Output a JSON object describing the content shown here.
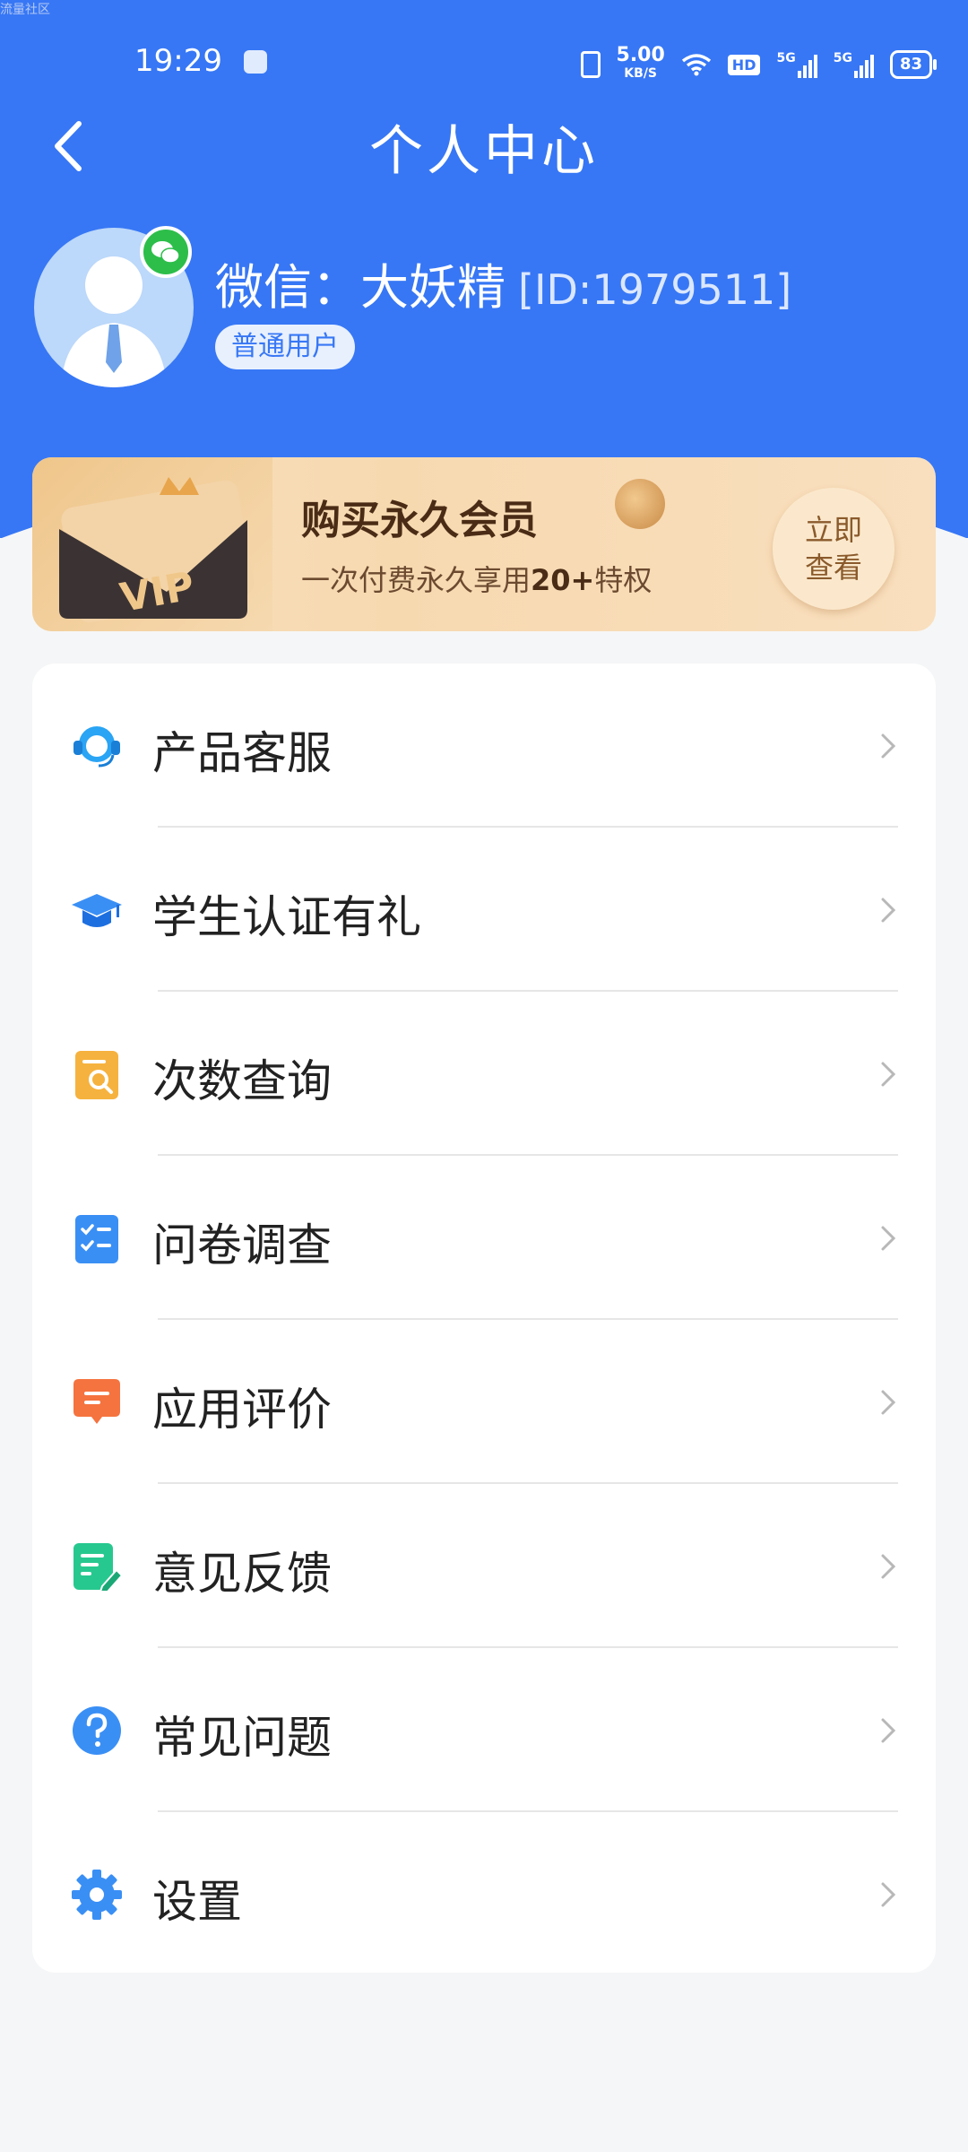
{
  "status_bar": {
    "time": "19:29",
    "net_speed_value": "5.00",
    "net_speed_unit": "KB/S",
    "hd_label": "HD",
    "signal1_label": "5G",
    "signal2_label": "5G",
    "battery": "83"
  },
  "watermark": "流量社区",
  "header": {
    "title": "个人中心",
    "back_icon": "chevron-left-icon"
  },
  "profile": {
    "name": "微信：大妖精",
    "id_text": "[ID:1979511]",
    "tag": "普通用户",
    "badge_icon": "wechat-icon"
  },
  "vip_banner": {
    "title": "购买永久会员",
    "subtitle_prefix": "一次付费永久享用",
    "subtitle_bold": "20+",
    "subtitle_suffix": "特权",
    "button_line1": "立即",
    "button_line2": "查看",
    "card_text": "VIP"
  },
  "menu": [
    {
      "label": "产品客服",
      "icon": "headset-icon",
      "color": "#2aa4f4"
    },
    {
      "label": "学生认证有礼",
      "icon": "graduation-cap-icon",
      "color": "#3a8ff5"
    },
    {
      "label": "次数查询",
      "icon": "search-document-icon",
      "color": "#f6b23e"
    },
    {
      "label": "问卷调查",
      "icon": "checklist-icon",
      "color": "#3a8ff5"
    },
    {
      "label": "应用评价",
      "icon": "message-icon",
      "color": "#f5733f"
    },
    {
      "label": "意见反馈",
      "icon": "edit-note-icon",
      "color": "#27c88f"
    },
    {
      "label": "常见问题",
      "icon": "question-icon",
      "color": "#3a8ff5"
    },
    {
      "label": "设置",
      "icon": "gear-icon",
      "color": "#3a8ff5"
    }
  ]
}
